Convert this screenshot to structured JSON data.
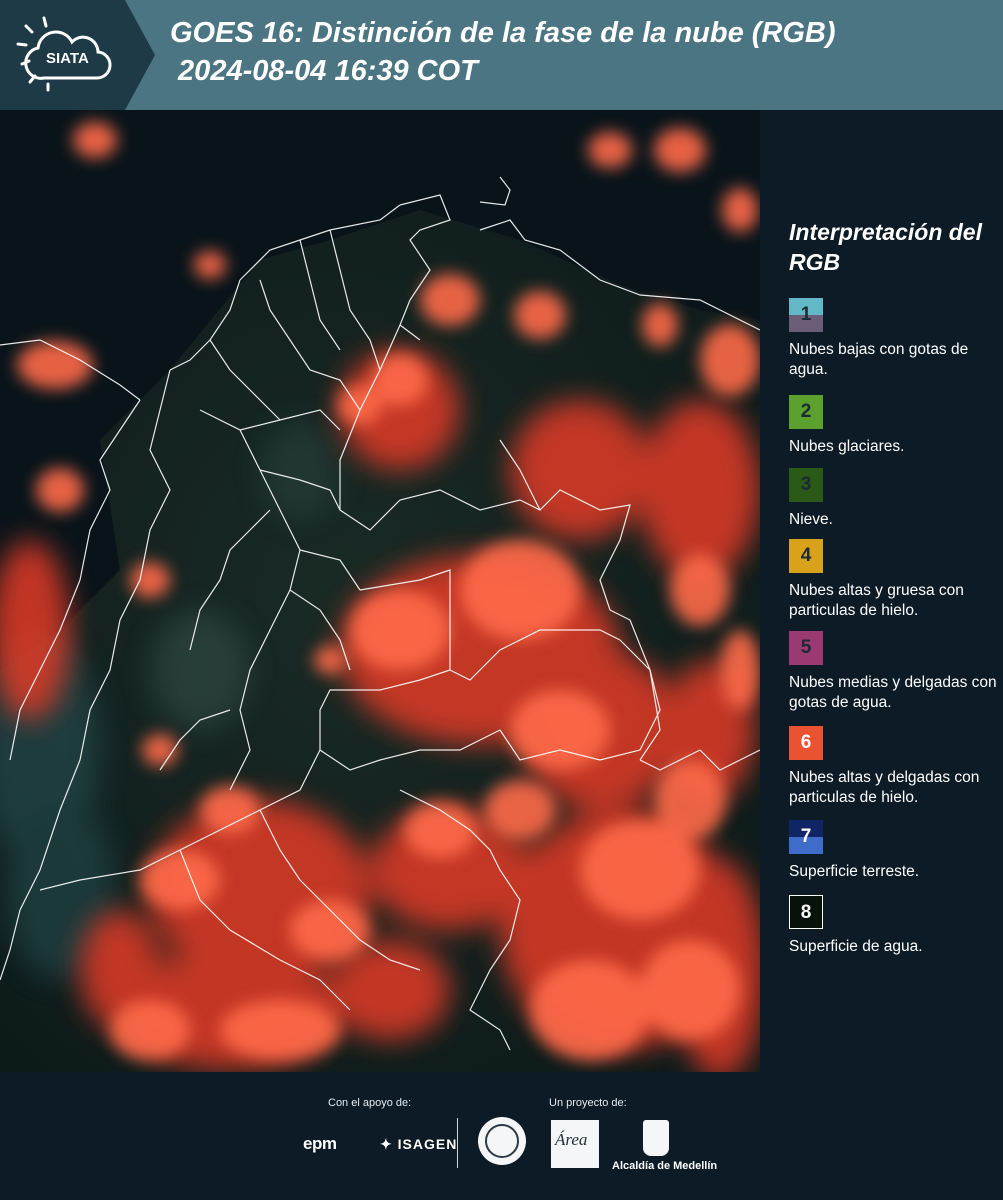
{
  "header": {
    "logo_text": "SIATA",
    "title_line1": "GOES 16: Distinción de la fase de la nube (RGB)",
    "title_line2": " 2024-08-04 16:39 COT",
    "background": "#4c7583"
  },
  "legend": {
    "title": "Interpretación del RGB",
    "items": [
      {
        "number": "1",
        "top": "#62b8c6",
        "bottom": "#6b5c78",
        "description": "Nubes bajas con gotas de agua."
      },
      {
        "number": "2",
        "top": "#5ca02e",
        "bottom": "#5ca02e",
        "description": "Nubes glaciares."
      },
      {
        "number": "3",
        "top": "#2b5a18",
        "bottom": "#2b5a18",
        "description": "Nieve."
      },
      {
        "number": "4",
        "top": "#d9a21a",
        "bottom": "#d9a21a",
        "description": "Nubes altas y gruesa con particulas de hielo."
      },
      {
        "number": "5",
        "top": "#9b3a72",
        "bottom": "#9b3a72",
        "description": "Nubes medias y delgadas con gotas de agua."
      },
      {
        "number": "6",
        "top": "#e9532f",
        "bottom": "#e9532f",
        "description": "Nubes altas y delgadas con particulas de hielo."
      },
      {
        "number": "7",
        "top": "#0f2566",
        "bottom": "#3f6cc9",
        "description": "Superficie terreste."
      },
      {
        "number": "8",
        "top": "#06120a",
        "bottom": "#06120a",
        "description": "Superficie de agua."
      }
    ]
  },
  "footer": {
    "support_label": "Con el apoyo de:",
    "project_label": "Un proyecto de:",
    "sponsor1": "epm",
    "sponsor2": "ISAGEN",
    "amva_text": "Área",
    "medellin_label": "Alcaldía de Medellín"
  },
  "colors": {
    "cloud_red": "#f0442e",
    "cloud_highlight": "#ff7a5c",
    "land_dark": "#12201d",
    "sea_dark": "#08141a",
    "border_white": "#ffffff"
  }
}
